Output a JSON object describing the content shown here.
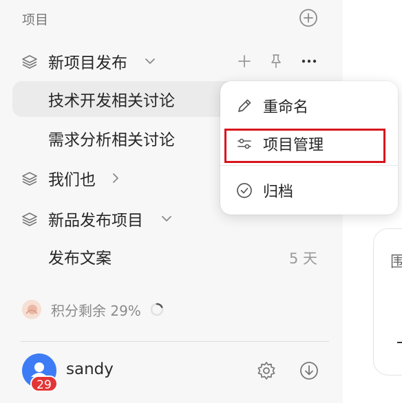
{
  "sidebar": {
    "section_title": "项目",
    "groups": [
      {
        "label": "新项目发布",
        "expanded": true,
        "items": [
          {
            "label": "技术开发相关讨论",
            "selected": true
          },
          {
            "label": "需求分析相关讨论"
          }
        ]
      },
      {
        "label": "我们也",
        "expanded": false,
        "items": []
      },
      {
        "label": "新品发布项目",
        "expanded": true,
        "items": [
          {
            "label": "发布文案",
            "age": "5 天"
          }
        ]
      }
    ],
    "credits": {
      "label": "积分剩余 29%",
      "percent": 29
    },
    "user": {
      "name": "sandy",
      "badge_count": "29"
    }
  },
  "context_menu": {
    "items": [
      {
        "label": "重命名",
        "icon": "pencil-icon"
      },
      {
        "label": "项目管理",
        "icon": "sliders-icon",
        "highlighted": true
      },
      {
        "label": "归档",
        "icon": "check-circle-icon"
      }
    ]
  },
  "right_pane": {
    "card_char": "围"
  },
  "colors": {
    "sidebar_bg": "#f7f7f7",
    "selected_bg": "#ebebeb",
    "avatar_blue": "#3d7cf5",
    "badge_red": "#e33535",
    "highlight_red": "#d9141c"
  }
}
